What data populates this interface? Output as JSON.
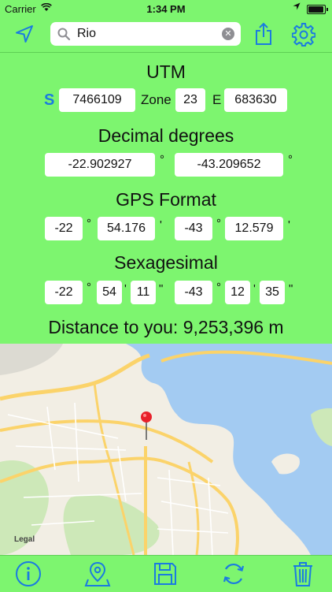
{
  "status": {
    "carrier": "Carrier",
    "time": "1:34 PM"
  },
  "search": {
    "value": "Rio"
  },
  "utm": {
    "heading": "UTM",
    "hemisphere": "S",
    "northing": "7466109",
    "zone_label": "Zone",
    "zone": "23",
    "easting_label": "E",
    "easting": "683630"
  },
  "decimal": {
    "heading": "Decimal degrees",
    "lat": "-22.902927",
    "lon": "-43.209652",
    "deg_symbol": "°"
  },
  "gps": {
    "heading": "GPS Format",
    "lat_deg": "-22",
    "lat_min": "54.176",
    "lon_deg": "-43",
    "lon_min": "12.579",
    "deg_symbol": "°",
    "min_symbol": "'"
  },
  "sexagesimal": {
    "heading": "Sexagesimal",
    "lat_deg": "-22",
    "lat_min": "54",
    "lat_sec": "11",
    "lon_deg": "-43",
    "lon_min": "12",
    "lon_sec": "35",
    "deg_symbol": "°",
    "min_symbol": "'",
    "sec_symbol": "\""
  },
  "distance": {
    "text": "Distance to you: 9,253,396 m"
  },
  "map": {
    "legal": "Legal"
  },
  "colors": {
    "background": "#7df56f",
    "accent": "#1a7be0",
    "water": "#a3cbf2",
    "land": "#f2eee4",
    "road": "#fbd36a",
    "park": "#cde8b8"
  },
  "icons": {
    "top_left": "location-arrow-icon",
    "share": "share-icon",
    "settings": "gear-icon",
    "info": "info-icon",
    "map_pin": "map-pin-icon",
    "save": "floppy-disk-icon",
    "refresh": "refresh-icon",
    "delete": "trash-icon"
  }
}
